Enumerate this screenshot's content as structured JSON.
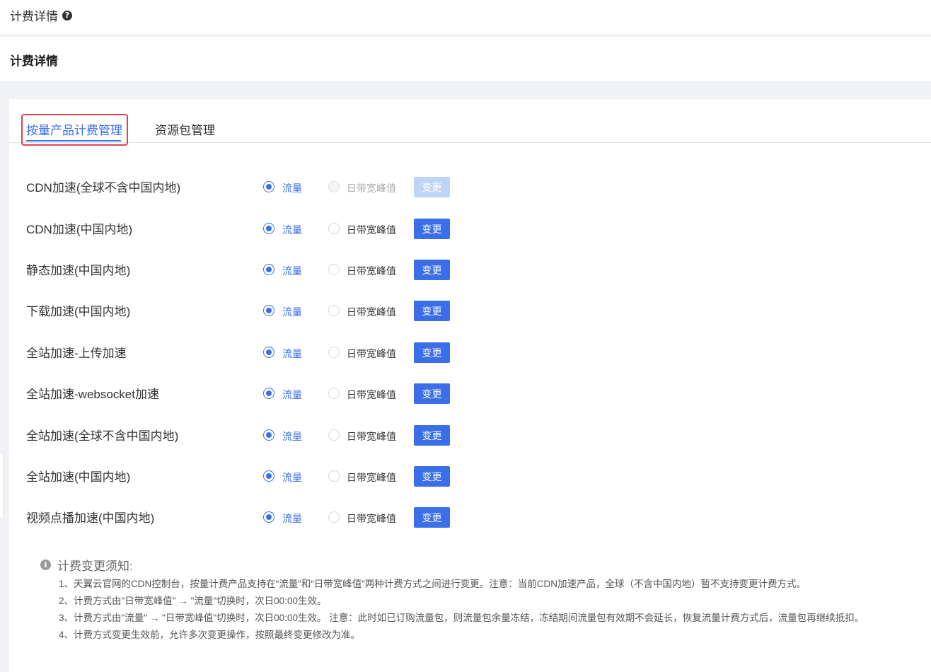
{
  "header": {
    "title": "计费详情",
    "help_icon": "question-circle-icon"
  },
  "section": {
    "title": "计费详情"
  },
  "tabs": [
    {
      "label": "按量产品计费管理",
      "active": true
    },
    {
      "label": "资源包管理",
      "active": false
    }
  ],
  "options": {
    "traffic": "流量",
    "peak": "日带宽峰值",
    "change": "变更"
  },
  "rows": [
    {
      "name": "CDN加速(全球不含中国内地)",
      "selected": "流量",
      "disabled": true
    },
    {
      "name": "CDN加速(中国内地)",
      "selected": "流量",
      "disabled": false
    },
    {
      "name": "静态加速(中国内地)",
      "selected": "流量",
      "disabled": false
    },
    {
      "name": "下载加速(中国内地)",
      "selected": "流量",
      "disabled": false
    },
    {
      "name": "全站加速-上传加速",
      "selected": "流量",
      "disabled": false
    },
    {
      "name": "全站加速-websocket加速",
      "selected": "流量",
      "disabled": false
    },
    {
      "name": "全站加速(全球不含中国内地)",
      "selected": "流量",
      "disabled": false
    },
    {
      "name": "全站加速(中国内地)",
      "selected": "流量",
      "disabled": false
    },
    {
      "name": "视频点播加速(中国内地)",
      "selected": "流量",
      "disabled": false
    }
  ],
  "notes": {
    "title": "计费变更须知:",
    "icon": "info-circle-icon",
    "items": [
      "1、天翼云官网的CDN控制台，按量计费产品支持在“流量”和“日带宽峰值”两种计费方式之间进行变更。注意：当前CDN加速产品，全球（不含中国内地）暂不支持变更计费方式。",
      "2、计费方式由\"日带宽峰值\" → \"流量\"切换时，次日00:00生效。",
      "3、计费方式由\"流量\" → \"日带宽峰值\"切换时，次日00:00生效。 注意：此时如已订购流量包，则流量包余量冻结，冻结期间流量包有效期不会延长，恢复流量计费方式后，流量包再继续抵扣。",
      "4、计费方式变更生效前，允许多次变更操作，按照最终变更修改为准。"
    ]
  },
  "colors": {
    "primary": "#3a6fe8",
    "highlight_box": "#e0434b",
    "disabled_button": "#c0d4f8"
  }
}
